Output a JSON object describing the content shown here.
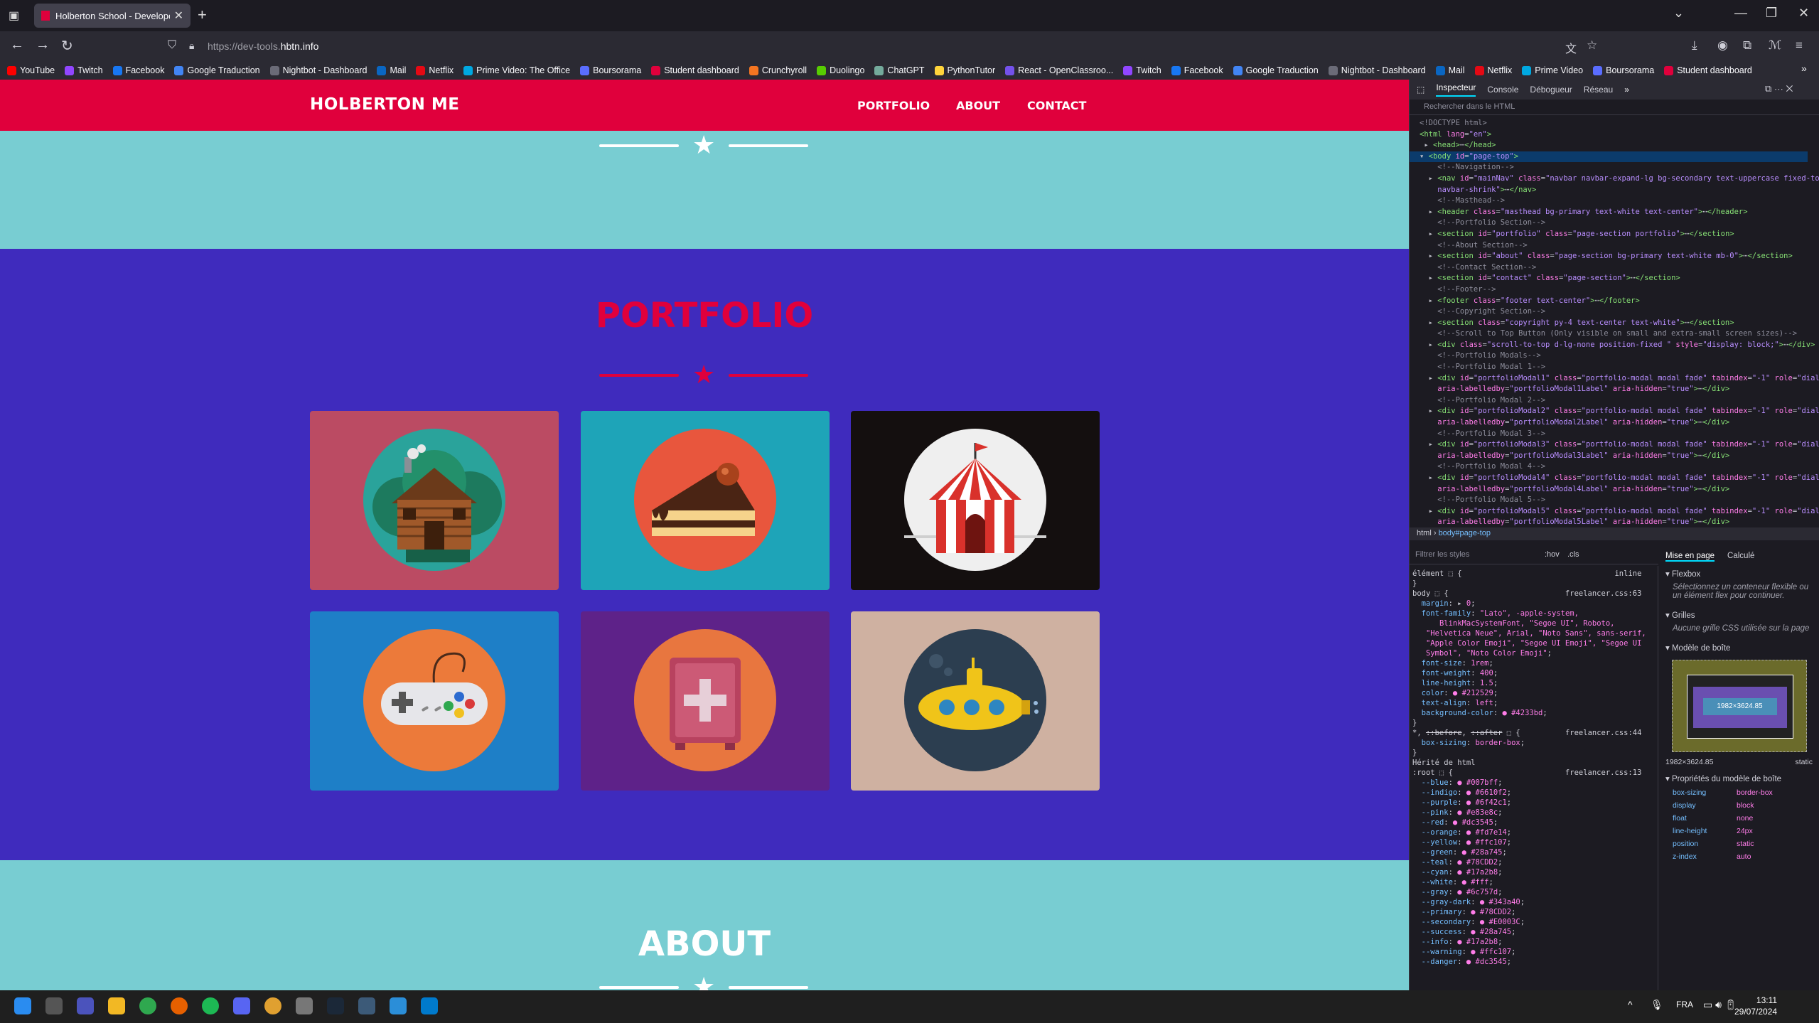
{
  "browser": {
    "tab_title": "Holberton School - Developer t",
    "url_prefix": "https://dev-tools.",
    "url_domain": "hbtn.info",
    "bookmarks": [
      {
        "label": "YouTube",
        "color": "#ff0000"
      },
      {
        "label": "Twitch",
        "color": "#9146ff"
      },
      {
        "label": "Facebook",
        "color": "#1877f2"
      },
      {
        "label": "Google Traduction",
        "color": "#4285f4"
      },
      {
        "label": "Nightbot - Dashboard",
        "color": "#6b6b78"
      },
      {
        "label": "Mail",
        "color": "#0a66c2"
      },
      {
        "label": "Netflix",
        "color": "#e50914"
      },
      {
        "label": "Prime Video: The Office",
        "color": "#00a8e1"
      },
      {
        "label": "Boursorama",
        "color": "#5a6dff"
      },
      {
        "label": "Student dashboard",
        "color": "#e0003c"
      },
      {
        "label": "Crunchyroll",
        "color": "#f47521"
      },
      {
        "label": "Duolingo",
        "color": "#58cc02"
      },
      {
        "label": "ChatGPT",
        "color": "#74aa9c"
      },
      {
        "label": "PythonTutor",
        "color": "#ffd43b"
      },
      {
        "label": "React - OpenClassroo...",
        "color": "#7451eb"
      },
      {
        "label": "Twitch",
        "color": "#9146ff"
      },
      {
        "label": "Facebook",
        "color": "#1877f2"
      },
      {
        "label": "Google Traduction",
        "color": "#4285f4"
      },
      {
        "label": "Nightbot - Dashboard",
        "color": "#6b6b78"
      },
      {
        "label": "Mail",
        "color": "#0a66c2"
      },
      {
        "label": "Netflix",
        "color": "#e50914"
      },
      {
        "label": "Prime Video",
        "color": "#00a8e1"
      },
      {
        "label": "Boursorama",
        "color": "#5a6dff"
      },
      {
        "label": "Student dashboard",
        "color": "#e0003c"
      }
    ]
  },
  "site": {
    "brand": "HOLBERTON ME",
    "nav": {
      "portfolio": "PORTFOLIO",
      "about": "ABOUT",
      "contact": "CONTACT"
    },
    "portfolio_title": "PORTFOLIO",
    "about_title": "ABOUT",
    "colors": {
      "primary": "#78cdd2",
      "secondary": "#e0003c",
      "portfolio_bg": "#3f2bbd"
    },
    "cards": [
      {
        "icon": "cabin-icon",
        "bg": "#bb4b63"
      },
      {
        "icon": "cake-icon",
        "bg": "#1ea4b8"
      },
      {
        "icon": "circus-tent-icon",
        "bg": "#140f0f"
      },
      {
        "icon": "game-controller-icon",
        "bg": "#1e7fc7"
      },
      {
        "icon": "safe-icon",
        "bg": "#5e2289"
      },
      {
        "icon": "submarine-icon",
        "bg": "#cfb1a1"
      }
    ]
  },
  "devtools": {
    "tabs": {
      "inspector": "Inspecteur",
      "console": "Console",
      "debugger": "Débogueur",
      "network": "Réseau"
    },
    "search_placeholder": "Rechercher dans le HTML",
    "breadcrumb_html": "html",
    "breadcrumb_body": "body#page-top",
    "styles_filter": "Filtrer les styles",
    "hov": ":hov",
    "cls": ".cls",
    "layout_tabs": {
      "layout": "Mise en page",
      "computed": "Calculé"
    },
    "flexbox_title": "Flexbox",
    "flexbox_text": "Sélectionnez un conteneur flexible ou un élément flex pour continuer.",
    "grid_title": "Grilles",
    "grid_text": "Aucune grille CSS utilisée sur la page",
    "boxmodel_title": "Modèle de boîte",
    "box_size": "1982×3624.85",
    "box_position": "static",
    "box_props_title": "Propriétés du modèle de boîte",
    "box_props": [
      {
        "k": "box-sizing",
        "v": "border-box"
      },
      {
        "k": "display",
        "v": "block"
      },
      {
        "k": "float",
        "v": "none"
      },
      {
        "k": "line-height",
        "v": "24px"
      },
      {
        "k": "position",
        "v": "static"
      },
      {
        "k": "z-index",
        "v": "auto"
      }
    ],
    "inherited_label": "Hérité de html"
  },
  "taskbar": {
    "lang": "FRA",
    "time": "13:11",
    "date": "29/07/2024"
  }
}
